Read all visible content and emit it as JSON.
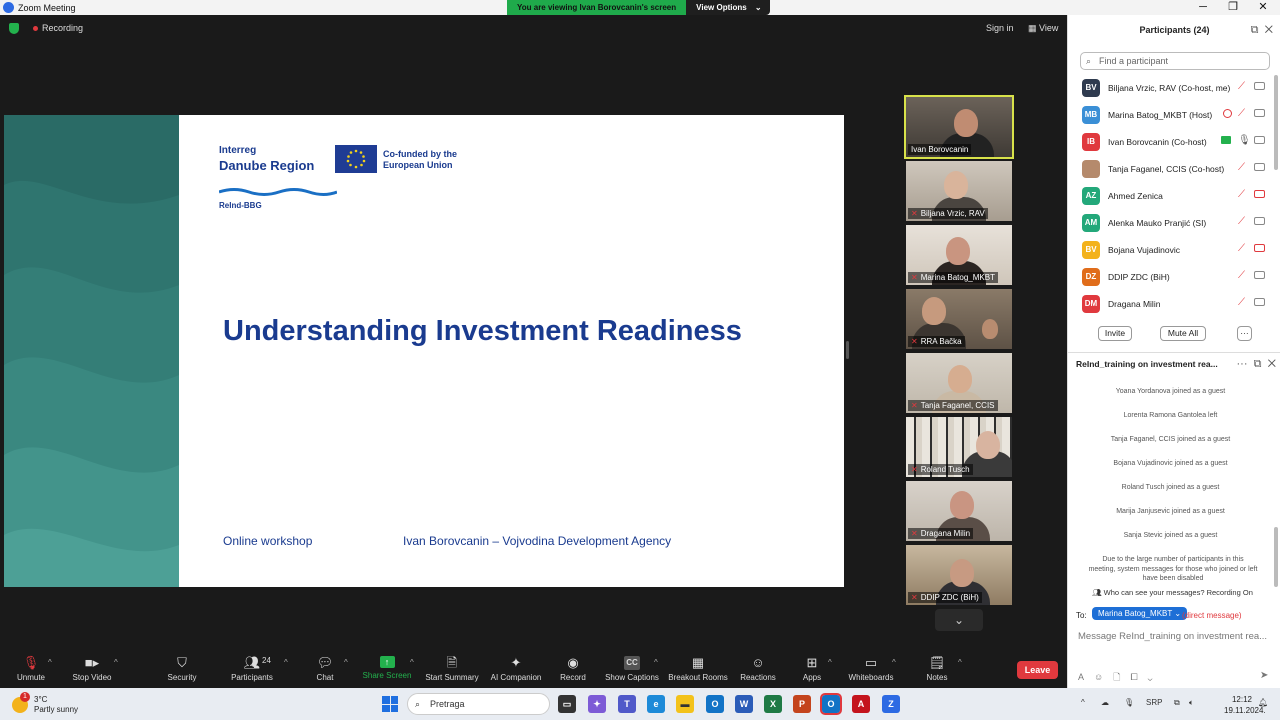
{
  "window": {
    "title": "Zoom Meeting",
    "minimize": "─",
    "maximize": "❐",
    "close": "✕"
  },
  "banner": {
    "viewing": "You are viewing Ivan Borovcanin's screen",
    "options": "View Options",
    "caret": "⌄"
  },
  "topbar": {
    "recording": "Recording",
    "sign_in": "Sign in",
    "view": "View"
  },
  "slide": {
    "logo_line1": "Interreg",
    "logo_line2": "Danube Region",
    "eu_text": "Co-funded by the European Union",
    "project": "ReInd-BBG",
    "title": "Understanding Investment  Readiness",
    "footer_left": "Online workshop",
    "footer_right": "Ivan Borovcanin – Vojvodina Development Agency"
  },
  "thumbnails": [
    {
      "name": "Ivan Borovcanin",
      "muted": false,
      "active": true
    },
    {
      "name": "Biljana Vrzic, RAV",
      "muted": true
    },
    {
      "name": "Marina Batog_MKBT",
      "muted": true
    },
    {
      "name": "RRA Bačka",
      "muted": true
    },
    {
      "name": "Tanja Faganel, CCIS",
      "muted": true
    },
    {
      "name": "Roland Tusch",
      "muted": true
    },
    {
      "name": "Dragana Milin",
      "muted": true
    },
    {
      "name": "DDIP ZDC (BiH)",
      "muted": true
    }
  ],
  "toolbar": {
    "unmute": "Unmute",
    "stop_video": "Stop Video",
    "security": "Security",
    "participants": "Participants",
    "participants_count": "24",
    "chat": "Chat",
    "share_screen": "Share Screen",
    "start_summary": "Start Summary",
    "ai_companion": "AI Companion",
    "record": "Record",
    "show_captions": "Show Captions",
    "breakout_rooms": "Breakout Rooms",
    "reactions": "Reactions",
    "apps": "Apps",
    "whiteboards": "Whiteboards",
    "notes": "Notes",
    "leave": "Leave",
    "cc": "CC"
  },
  "participants_panel": {
    "title": "Participants (24)",
    "search_placeholder": "Find a participant",
    "list": [
      {
        "initials": "BV",
        "name": "Biljana Vrzic, RAV (Co-host, me)",
        "color": "#2f3b4f",
        "video_off": false
      },
      {
        "initials": "MB",
        "name": "Marina Batog_MKBT (Host)",
        "color": "#3a8fd6",
        "video_off": false
      },
      {
        "initials": "IB",
        "name": "Ivan Borovcanin (Co-host)",
        "color": "#e0393e",
        "video_off": false
      },
      {
        "initials": "",
        "name": "Tanja Faganel, CCIS (Co-host)",
        "color": "#b58a6c",
        "video_off": false
      },
      {
        "initials": "AZ",
        "name": "Ahmed Zenica",
        "color": "#23a87a",
        "video_off": true
      },
      {
        "initials": "AM",
        "name": "Alenka Mauko Pranjić (SI)",
        "color": "#23a87a",
        "video_off": false
      },
      {
        "initials": "BV",
        "name": "Bojana Vujadinovic",
        "color": "#f3b21b",
        "video_off": true
      },
      {
        "initials": "DZ",
        "name": "DDIP ZDC (BiH)",
        "color": "#e06d1b",
        "video_off": false
      },
      {
        "initials": "DM",
        "name": "Dragana Milin",
        "color": "#e0393e",
        "video_off": false
      }
    ],
    "invite": "Invite",
    "mute_all": "Mute All",
    "more": "···"
  },
  "chat_panel": {
    "title": "ReInd_training on investment rea...",
    "messages": [
      "Yoana Yordanova joined as a guest",
      "Lorenta Ramona Gantolea left",
      "Tanja Faganel, CCIS joined as a guest",
      "Bojana Vujadinovic joined as a guest",
      "Roland Tusch joined as a guest",
      "Marija Janjusevic joined as a guest",
      "Sanja Stevic joined as a guest"
    ],
    "system_note": "Due to the large number of participants in this meeting, system messages for those who joined or left have been disabled",
    "who_can_see": "Who can see your messages? Recording On",
    "to_label": "To:",
    "recipient": "Marina Batog_MKBT ⌄",
    "direct_message": "(direct message)",
    "input_placeholder": "Message ReInd_training on investment rea..."
  },
  "taskbar": {
    "temperature": "3°C",
    "weather": "Partly sunny",
    "badge": "1",
    "search_placeholder": "Pretraga",
    "language": "SRP",
    "time": "12:12",
    "date": "19.11.2024."
  }
}
